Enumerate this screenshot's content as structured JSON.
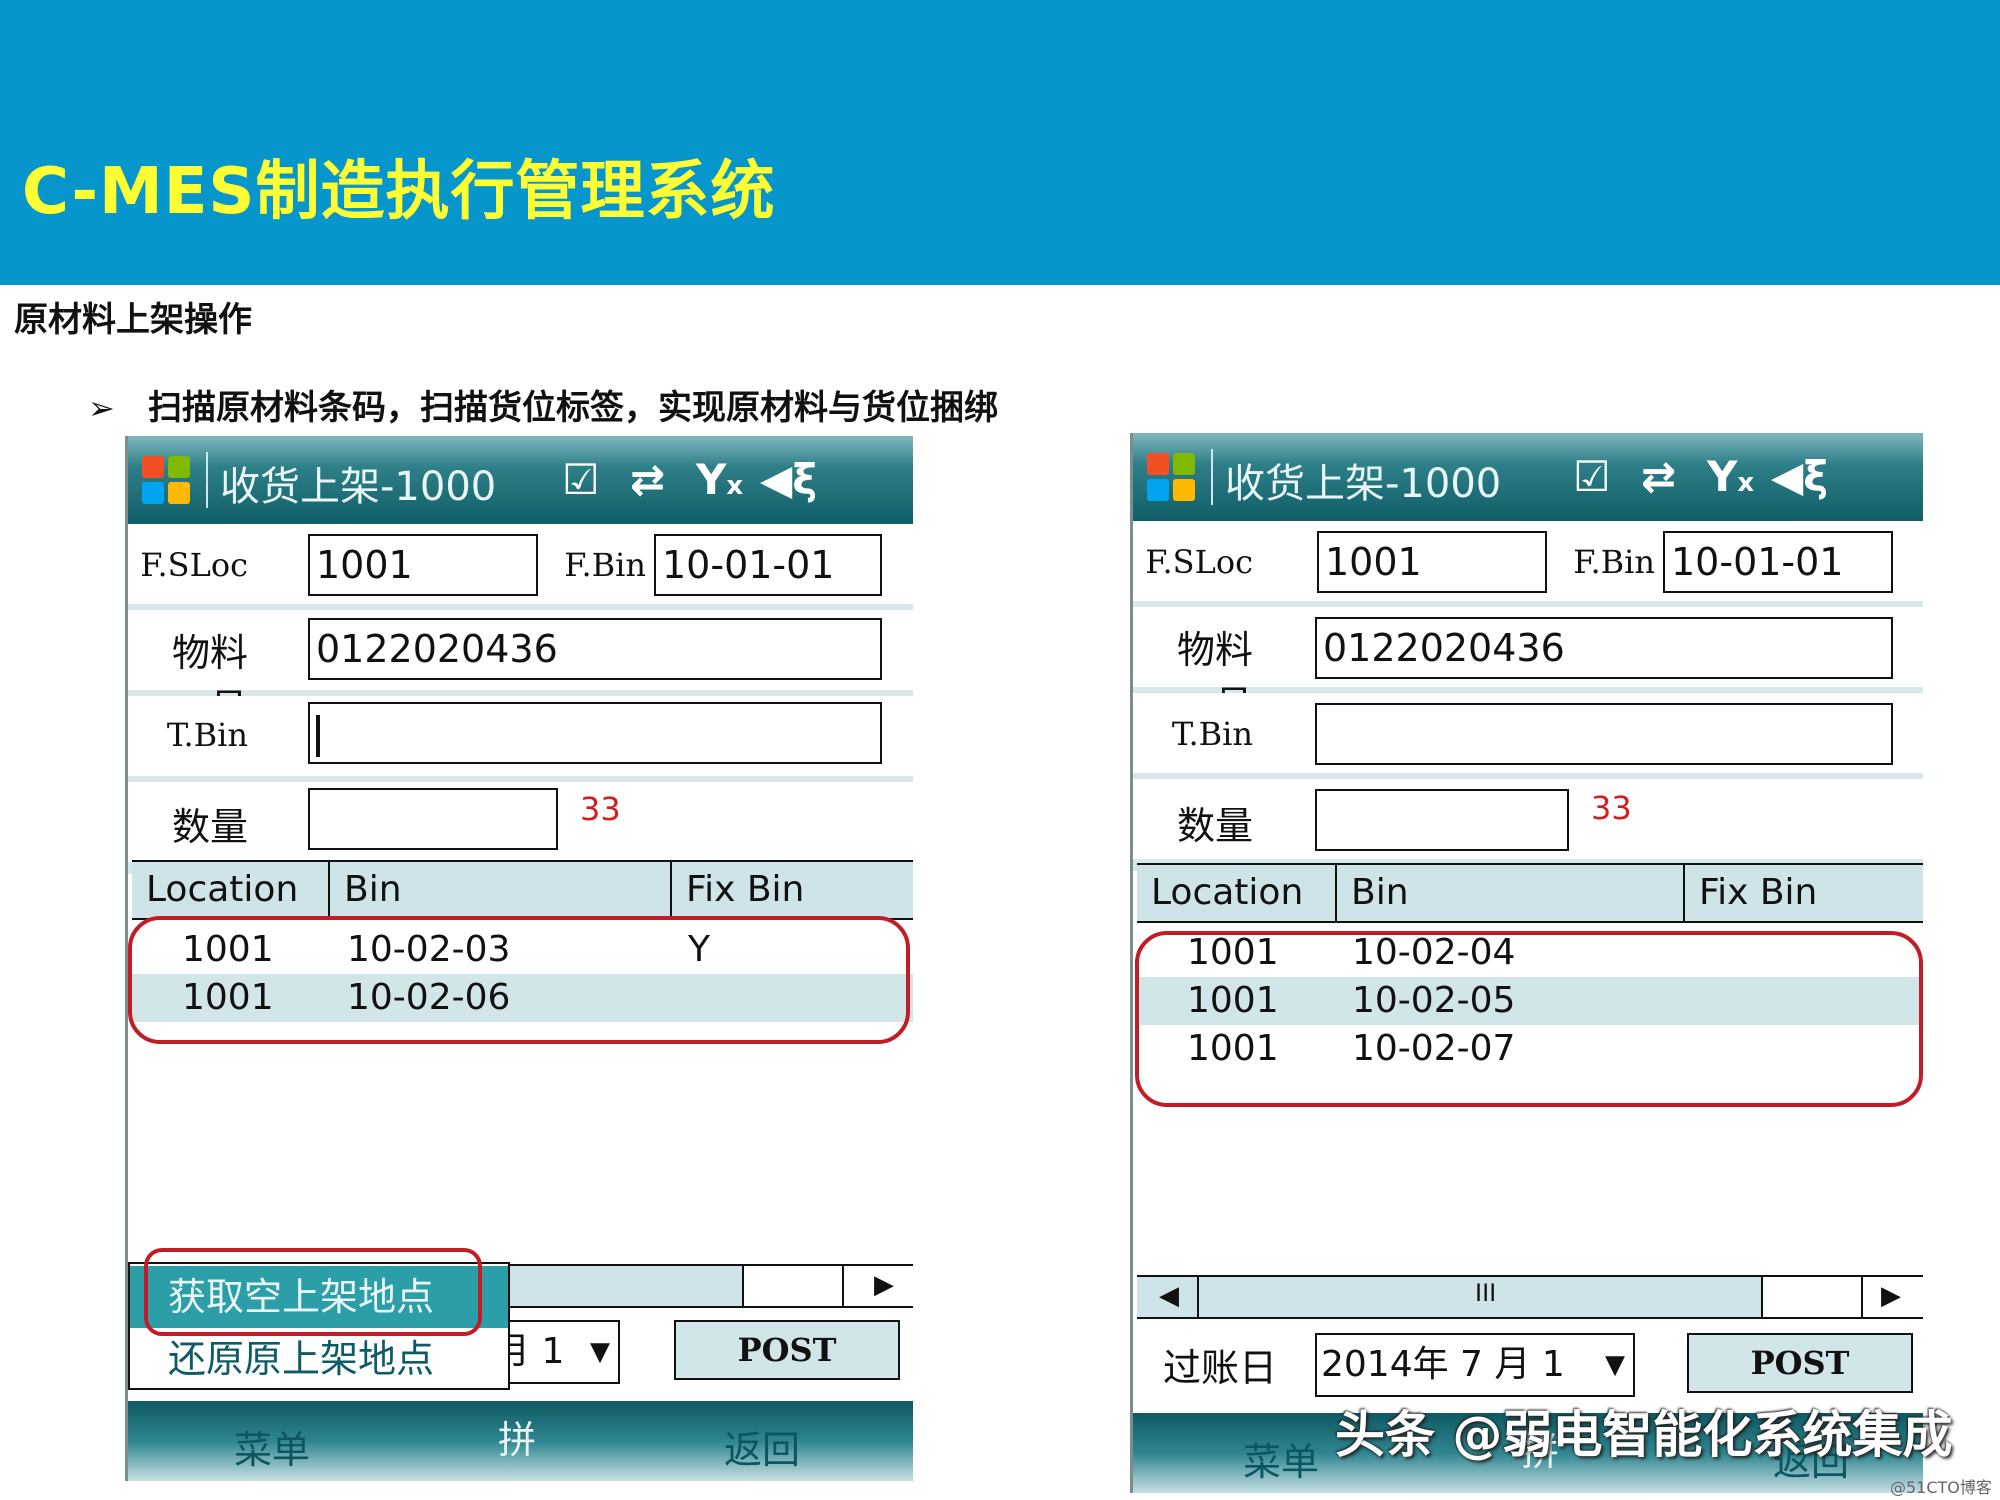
{
  "slide": {
    "banner_title": "C-MES制造执行管理系统",
    "section_title": "原材料上架操作",
    "bullet_symbol": "➢",
    "bullet_text": "扫描原材料条码，扫描货位标签，实现原材料与货位捆绑",
    "banner_color": "#0696cc",
    "banner_title_color": "#ffff33",
    "watermark": "头条 @弱电智能化系统集成",
    "watermark_small": "@51CTO博客"
  },
  "left": {
    "title": "收货上架-1000",
    "icons": [
      "check-box-icon",
      "transfer-arrows-icon",
      "no-signal-icon",
      "speaker-muted-icon"
    ],
    "form": {
      "fsloc_label": "F.SLoc",
      "fsloc_value": "1001",
      "fbin_label": "F.Bin",
      "fbin_value": "10-01-01",
      "material_label": "物料号",
      "material_value": "0122020436",
      "tbin_label": "T.Bin",
      "tbin_value": "",
      "qty_label": "数量",
      "qty_value": "",
      "qty_hint": "33"
    },
    "grid": {
      "headers": [
        "Location",
        "Bin",
        "Fix Bin"
      ],
      "rows": [
        {
          "location": "1001",
          "bin": "10-02-03",
          "fix": "Y"
        },
        {
          "location": "1001",
          "bin": "10-02-06",
          "fix": ""
        }
      ]
    },
    "popup": {
      "items": [
        "获取空上架地点",
        "还原原上架地点"
      ]
    },
    "date_partial": "月 1",
    "post_label": "POST",
    "softkeys": {
      "menu": "菜单",
      "middle": "拼",
      "back": "返回"
    }
  },
  "right": {
    "title": "收货上架-1000",
    "icons": [
      "check-box-icon",
      "transfer-arrows-icon",
      "no-signal-icon",
      "speaker-muted-icon"
    ],
    "form": {
      "fsloc_label": "F.SLoc",
      "fsloc_value": "1001",
      "fbin_label": "F.Bin",
      "fbin_value": "10-01-01",
      "material_label": "物料号",
      "material_value": "0122020436",
      "tbin_label": "T.Bin",
      "tbin_value": "",
      "qty_label": "数量",
      "qty_value": "",
      "qty_hint": "33"
    },
    "grid": {
      "headers": [
        "Location",
        "Bin",
        "Fix Bin"
      ],
      "rows": [
        {
          "location": "1001",
          "bin": "10-02-04",
          "fix": ""
        },
        {
          "location": "1001",
          "bin": "10-02-05",
          "fix": ""
        },
        {
          "location": "1001",
          "bin": "10-02-07",
          "fix": ""
        }
      ]
    },
    "scroll_thumb": "III",
    "date_label": "过账日",
    "date_value": "2014年 7 月 1",
    "post_label": "POST",
    "softkeys": {
      "menu": "菜单",
      "middle": "拼",
      "back": "返回"
    }
  }
}
